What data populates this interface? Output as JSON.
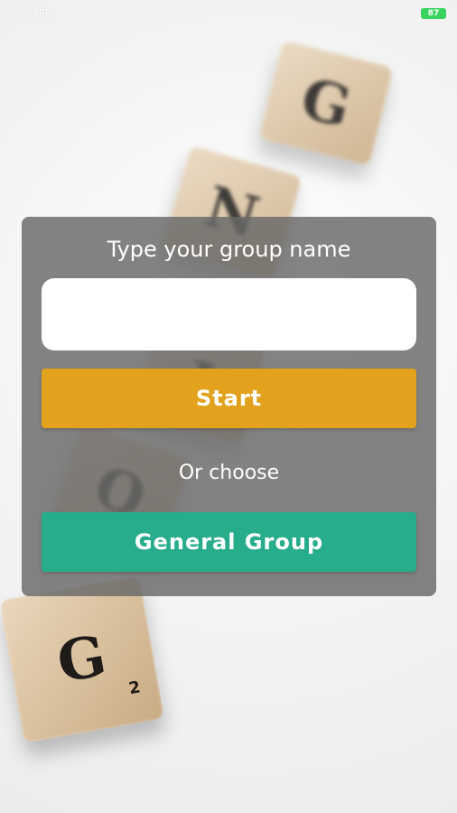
{
  "status_bar": {
    "time": "1:20 PM",
    "battery": "87"
  },
  "dialog": {
    "prompt": "Type your group name",
    "group_name_input": {
      "value": "",
      "placeholder": ""
    },
    "start_label": "Start",
    "or_choose_label": "Or choose",
    "general_group_label": "General Group"
  },
  "background": {
    "tiles": [
      {
        "letter": "G"
      },
      {
        "letter": "N"
      },
      {
        "letter": "I"
      },
      {
        "letter": "O"
      },
      {
        "letter": "G",
        "sub": "2"
      }
    ]
  },
  "colors": {
    "start_button": "#e2a21e",
    "general_group_button": "#27ad8c",
    "dialog_overlay": "#686868",
    "battery": "#39d45f"
  }
}
